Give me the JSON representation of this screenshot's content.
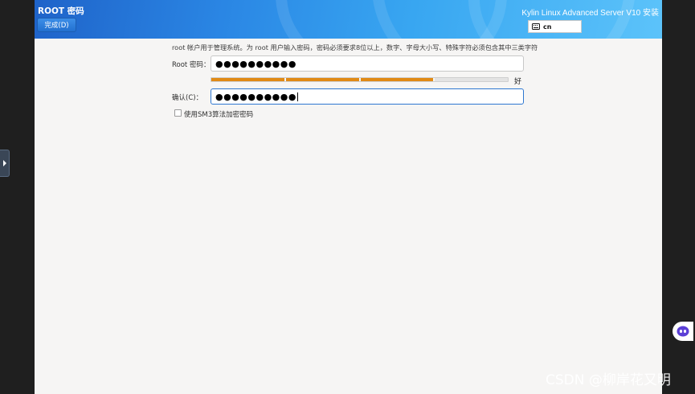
{
  "header": {
    "page_title": "ROOT 密码",
    "done_button": "完成(D)",
    "product_title": "Kylin Linux Advanced Server V10 安装",
    "keyboard_layout": "cn"
  },
  "form": {
    "description": "root 帐户用于管理系统。为 root 用户输入密码，密码必须要求8位以上，数字、字母大小写、特殊字符必须包含其中三类字符",
    "root_password_label": "Root 密码：",
    "root_password_value": "●●●●●●●●●●",
    "strength_label": "好",
    "strength_level": 0.75,
    "confirm_label": "确认(C)：",
    "confirm_password_value": "●●●●●●●●●●",
    "sm3_label": "使用SM3算法加密密码",
    "sm3_checked": false
  },
  "watermark": "CSDN @柳岸花又明",
  "colors": {
    "header_start": "#1f63c9",
    "header_end": "#5cc3fa",
    "strength_fill": "#e08a16",
    "focus_border": "#2e77d0"
  },
  "icons": [
    "keyboard-icon",
    "chevron-right-icon",
    "assistant-icon"
  ]
}
